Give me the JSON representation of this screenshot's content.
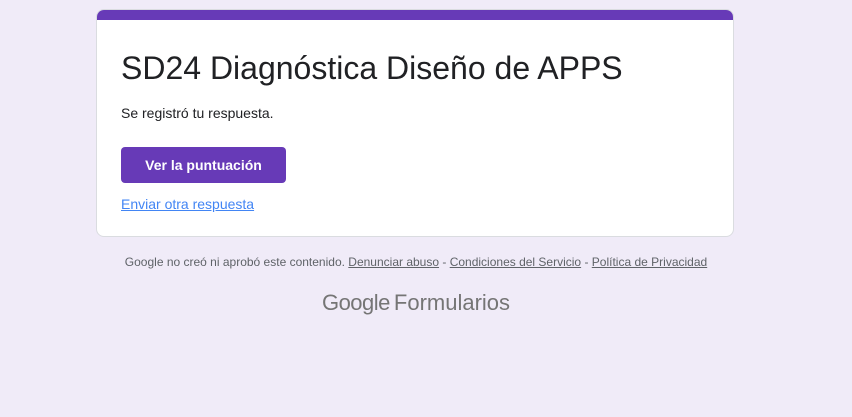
{
  "form": {
    "title": "SD24 Diagnóstica Diseño de APPS",
    "confirmation_message": "Se registró tu respuesta.",
    "view_score_label": "Ver la puntuación",
    "submit_another_label": "Enviar otra respuesta"
  },
  "footer": {
    "notice": "Google no creó ni aprobó este contenido.",
    "report_abuse": "Denunciar abuso",
    "separator": " - ",
    "terms": "Condiciones del Servicio",
    "privacy": "Política de Privacidad"
  },
  "brand": {
    "google": "Google",
    "product": "Formularios"
  },
  "colors": {
    "accent": "#673ab7",
    "background": "#f0ebf8",
    "link": "#4285f4"
  }
}
